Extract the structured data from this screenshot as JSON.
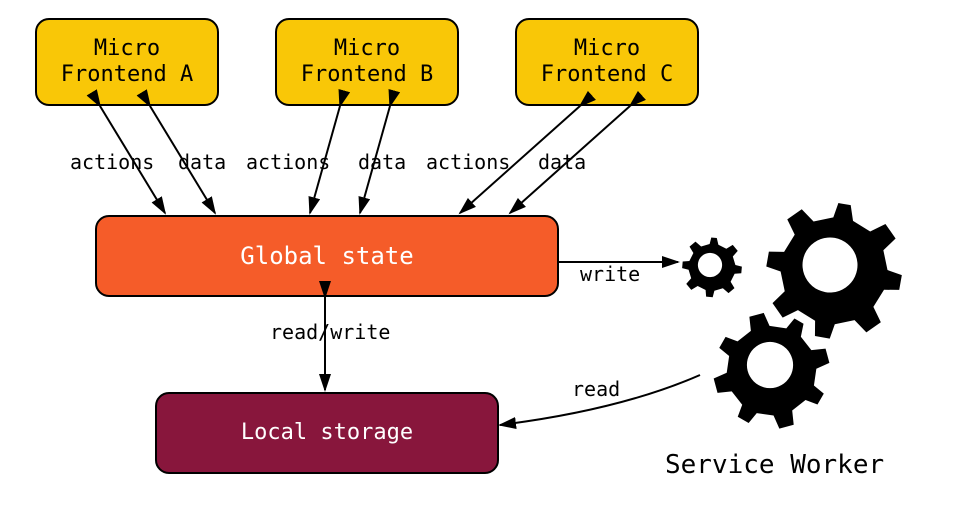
{
  "frontends": [
    {
      "label": "Micro\nFrontend A"
    },
    {
      "label": "Micro\nFrontend B"
    },
    {
      "label": "Micro\nFrontend C"
    }
  ],
  "global_state": {
    "label": "Global state"
  },
  "local_storage": {
    "label": "Local storage"
  },
  "service_worker": {
    "label": "Service Worker"
  },
  "edges": {
    "actions": "actions",
    "data": "data",
    "read_write": "read/write",
    "write": "write",
    "read": "read"
  },
  "colors": {
    "frontend_bg": "#f9c707",
    "global_bg": "#f55c29",
    "local_bg": "#88163c",
    "arrow": "#000000"
  }
}
